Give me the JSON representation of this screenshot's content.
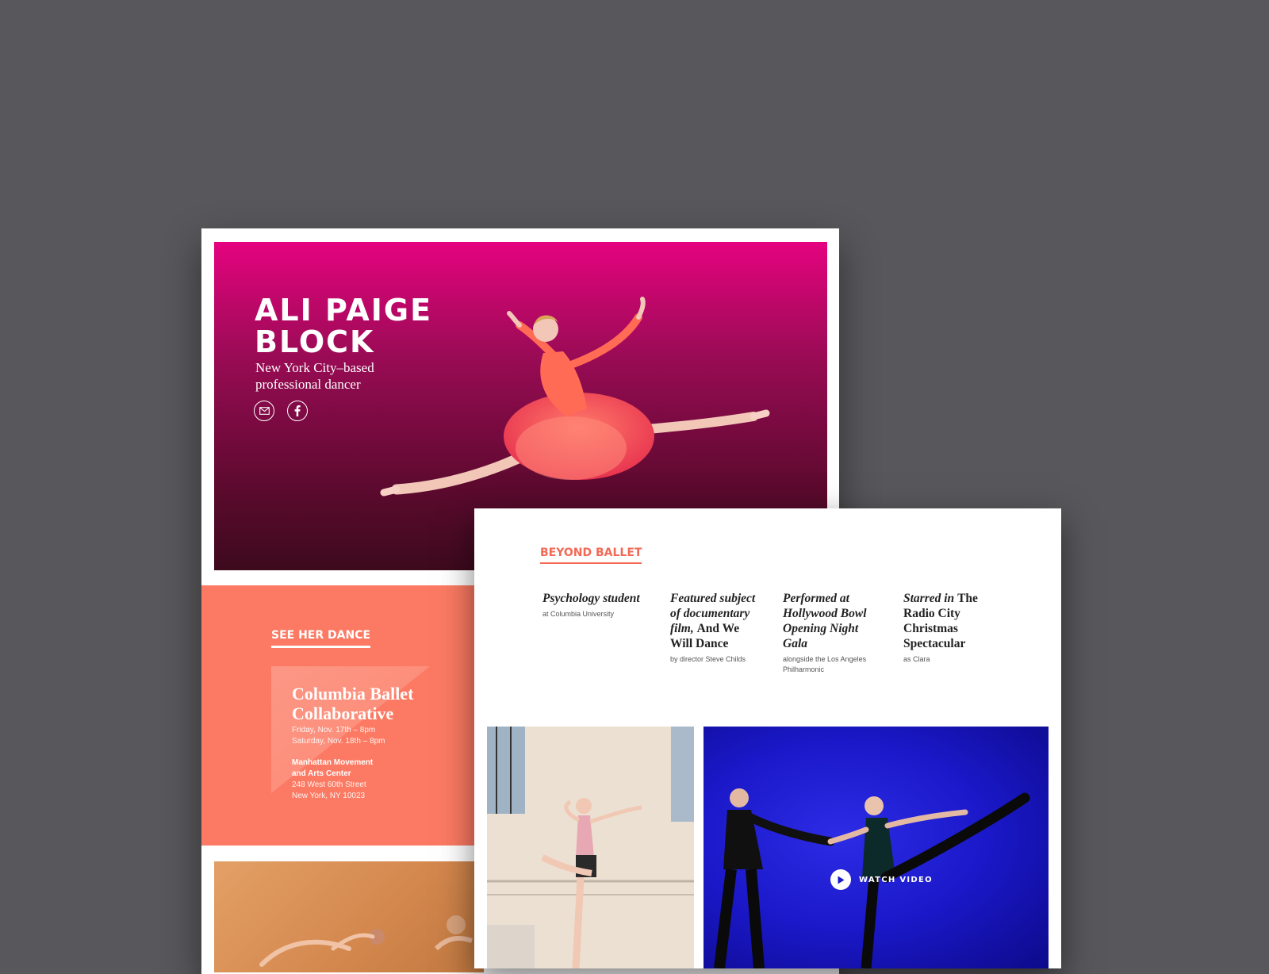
{
  "hero": {
    "name": "ALI PAIGE BLOCK",
    "tagline": "New York City–based professional dancer",
    "icons": [
      "mail-icon",
      "facebook-icon"
    ]
  },
  "dance": {
    "heading": "SEE HER DANCE",
    "event_title": "Columbia Ballet Collaborative",
    "dates": [
      "Friday, Nov. 17th – 8pm",
      "Saturday, Nov. 18th – 8pm"
    ],
    "venue": [
      "Manhattan Movement",
      "and Arts Center"
    ],
    "address": [
      "248 West 60th Street",
      "New York, NY 10023"
    ]
  },
  "beyond": {
    "heading": "BEYOND BALLET",
    "facts": [
      {
        "title_italic": "Psychology student",
        "title_plain": "",
        "sub": "at Columbia University"
      },
      {
        "title_italic": "Featured subject of documentary film,",
        "title_plain": "And We Will Dance",
        "sub": "by director Steve Childs"
      },
      {
        "title_italic": "Performed at Hollywood Bowl Opening Night Gala",
        "title_plain": "",
        "sub": "alongside the Los Angeles Philharmonic"
      },
      {
        "title_italic": "Starred in",
        "title_plain": "The Radio City Christmas Spectacular",
        "sub": "as Clara"
      }
    ]
  },
  "video": {
    "label": "WATCH VIDEO",
    "icon": "play-icon"
  },
  "colors": {
    "background": "#58585c",
    "hero_top": "#e5037f",
    "hero_bottom": "#3d0a1d",
    "coral": "#fc7a63",
    "accent": "#f26a55",
    "stage_blue": "#1a18c8"
  }
}
